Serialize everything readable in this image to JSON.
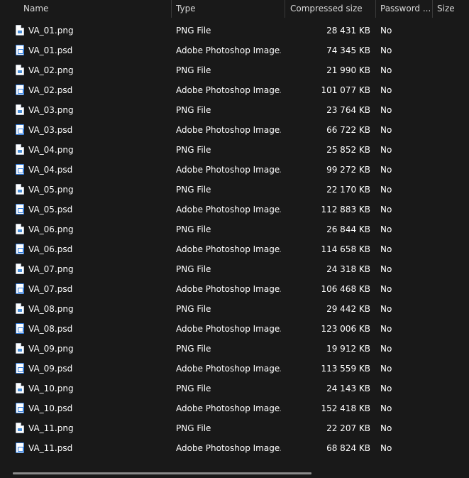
{
  "columns": {
    "name": "Name",
    "type": "Type",
    "compressed_size": "Compressed size",
    "password": "Password ...",
    "size": "Size"
  },
  "files": [
    {
      "name": "VA_01.png",
      "icon": "png-file-icon",
      "type": "PNG File",
      "compressed_size": "28 431 KB",
      "password": "No"
    },
    {
      "name": "VA_01.psd",
      "icon": "psd-file-icon",
      "type": "Adobe Photoshop Image....",
      "compressed_size": "74 345 KB",
      "password": "No"
    },
    {
      "name": "VA_02.png",
      "icon": "png-file-icon",
      "type": "PNG File",
      "compressed_size": "21 990 KB",
      "password": "No"
    },
    {
      "name": "VA_02.psd",
      "icon": "psd-file-icon",
      "type": "Adobe Photoshop Image....",
      "compressed_size": "101 077 KB",
      "password": "No"
    },
    {
      "name": "VA_03.png",
      "icon": "png-file-icon",
      "type": "PNG File",
      "compressed_size": "23 764 KB",
      "password": "No"
    },
    {
      "name": "VA_03.psd",
      "icon": "psd-file-icon",
      "type": "Adobe Photoshop Image....",
      "compressed_size": "66 722 KB",
      "password": "No"
    },
    {
      "name": "VA_04.png",
      "icon": "png-file-icon",
      "type": "PNG File",
      "compressed_size": "25 852 KB",
      "password": "No"
    },
    {
      "name": "VA_04.psd",
      "icon": "psd-file-icon",
      "type": "Adobe Photoshop Image....",
      "compressed_size": "99 272 KB",
      "password": "No"
    },
    {
      "name": "VA_05.png",
      "icon": "png-file-icon",
      "type": "PNG File",
      "compressed_size": "22 170 KB",
      "password": "No"
    },
    {
      "name": "VA_05.psd",
      "icon": "psd-file-icon",
      "type": "Adobe Photoshop Image....",
      "compressed_size": "112 883 KB",
      "password": "No"
    },
    {
      "name": "VA_06.png",
      "icon": "png-file-icon",
      "type": "PNG File",
      "compressed_size": "26 844 KB",
      "password": "No"
    },
    {
      "name": "VA_06.psd",
      "icon": "psd-file-icon",
      "type": "Adobe Photoshop Image....",
      "compressed_size": "114 658 KB",
      "password": "No"
    },
    {
      "name": "VA_07.png",
      "icon": "png-file-icon",
      "type": "PNG File",
      "compressed_size": "24 318 KB",
      "password": "No"
    },
    {
      "name": "VA_07.psd",
      "icon": "psd-file-icon",
      "type": "Adobe Photoshop Image....",
      "compressed_size": "106 468 KB",
      "password": "No"
    },
    {
      "name": "VA_08.png",
      "icon": "png-file-icon",
      "type": "PNG File",
      "compressed_size": "29 442 KB",
      "password": "No"
    },
    {
      "name": "VA_08.psd",
      "icon": "psd-file-icon",
      "type": "Adobe Photoshop Image....",
      "compressed_size": "123 006 KB",
      "password": "No"
    },
    {
      "name": "VA_09.png",
      "icon": "png-file-icon",
      "type": "PNG File",
      "compressed_size": "19 912 KB",
      "password": "No"
    },
    {
      "name": "VA_09.psd",
      "icon": "psd-file-icon",
      "type": "Adobe Photoshop Image....",
      "compressed_size": "113 559 KB",
      "password": "No"
    },
    {
      "name": "VA_10.png",
      "icon": "png-file-icon",
      "type": "PNG File",
      "compressed_size": "24 143 KB",
      "password": "No"
    },
    {
      "name": "VA_10.psd",
      "icon": "psd-file-icon",
      "type": "Adobe Photoshop Image....",
      "compressed_size": "152 418 KB",
      "password": "No"
    },
    {
      "name": "VA_11.png",
      "icon": "png-file-icon",
      "type": "PNG File",
      "compressed_size": "22 207 KB",
      "password": "No"
    },
    {
      "name": "VA_11.psd",
      "icon": "psd-file-icon",
      "type": "Adobe Photoshop Image....",
      "compressed_size": "68 824 KB",
      "password": "No"
    }
  ]
}
